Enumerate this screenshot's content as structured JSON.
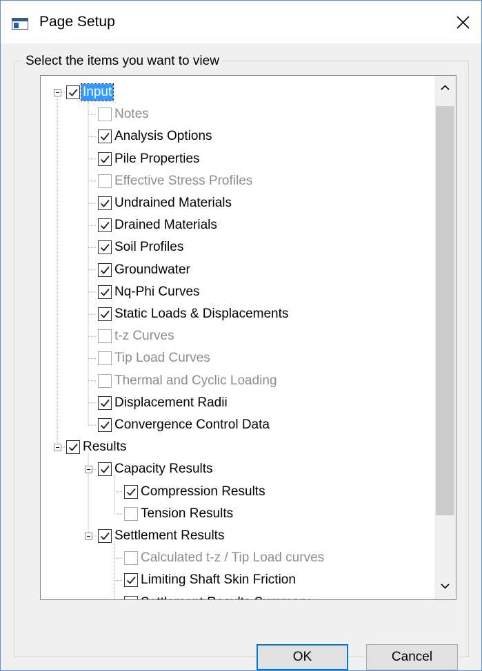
{
  "window": {
    "title": "Page Setup"
  },
  "group": {
    "label": "Select the items you want to view"
  },
  "tree": [
    {
      "label": "Input",
      "checked": true,
      "disabled": false,
      "selected": true
    },
    {
      "label": "Notes",
      "checked": false,
      "disabled": true
    },
    {
      "label": "Analysis Options",
      "checked": true,
      "disabled": false
    },
    {
      "label": "Pile Properties",
      "checked": true,
      "disabled": false
    },
    {
      "label": "Effective Stress Profiles",
      "checked": false,
      "disabled": true
    },
    {
      "label": "Undrained Materials",
      "checked": true,
      "disabled": false
    },
    {
      "label": "Drained Materials",
      "checked": true,
      "disabled": false
    },
    {
      "label": "Soil Profiles",
      "checked": true,
      "disabled": false
    },
    {
      "label": "Groundwater",
      "checked": true,
      "disabled": false
    },
    {
      "label": "Nq-Phi Curves",
      "checked": true,
      "disabled": false
    },
    {
      "label": "Static Loads & Displacements",
      "checked": true,
      "disabled": false
    },
    {
      "label": "t-z Curves",
      "checked": false,
      "disabled": true
    },
    {
      "label": "Tip Load Curves",
      "checked": false,
      "disabled": true
    },
    {
      "label": "Thermal and Cyclic Loading",
      "checked": false,
      "disabled": true
    },
    {
      "label": "Displacement Radii",
      "checked": true,
      "disabled": false
    },
    {
      "label": "Convergence Control Data",
      "checked": true,
      "disabled": false
    },
    {
      "label": "Results",
      "checked": true,
      "disabled": false
    },
    {
      "label": "Capacity Results",
      "checked": true,
      "disabled": false
    },
    {
      "label": "Compression Results",
      "checked": true,
      "disabled": false
    },
    {
      "label": "Tension Results",
      "checked": false,
      "disabled": false
    },
    {
      "label": "Settlement Results",
      "checked": true,
      "disabled": false
    },
    {
      "label": "Calculated t-z / Tip Load curves",
      "checked": false,
      "disabled": true
    },
    {
      "label": "Limiting Shaft Skin Friction",
      "checked": true,
      "disabled": false
    },
    {
      "label": "Settlement Results Summary",
      "checked": true,
      "disabled": false
    }
  ],
  "buttons": {
    "ok": "OK",
    "cancel": "Cancel"
  },
  "icons": {
    "close": "close-icon",
    "scroll_up": "chevron-up-icon",
    "scroll_down": "chevron-down-icon",
    "expander": "minus-box-icon",
    "checkbox": "checkmark-icon"
  },
  "colors": {
    "selection": "#3399ff",
    "window_border": "#5b8fd6",
    "default_button_border": "#0078d7"
  }
}
